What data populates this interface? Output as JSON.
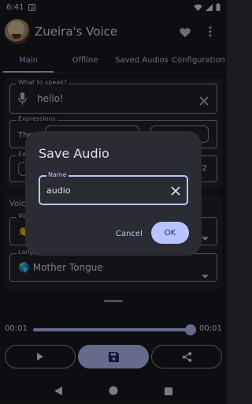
{
  "status_bar": {
    "time": "6:41",
    "notification_letter": "A"
  },
  "app_bar": {
    "title": "Zueira's Voice"
  },
  "tabs": [
    {
      "label": "Main",
      "active": true
    },
    {
      "label": "Offline",
      "active": false
    },
    {
      "label": "Saved Audios",
      "active": false
    },
    {
      "label": "Configuration",
      "active": false
    }
  ],
  "main": {
    "speak_field": {
      "label": "What to speak?",
      "value": "hello!"
    },
    "expressions": {
      "label": "Expressions",
      "partial_value": "The"
    },
    "second_field": {
      "label": "Ex",
      "partial_value": "2"
    },
    "voice_section": {
      "title": "Voic",
      "voice_label": "Vo",
      "voice_emoji": "👏"
    },
    "language": {
      "label": "Lang",
      "value": "🌎 Mother Tongue"
    }
  },
  "dialog": {
    "title": "Save Audio",
    "name_label": "Name",
    "name_value": "audio",
    "cancel_label": "Cancel",
    "ok_label": "OK"
  },
  "player": {
    "current_time": "00:01",
    "total_time": "00:01",
    "progress": 1.0
  },
  "colors": {
    "accent": "#b7c4ff",
    "background": "#1b1b21",
    "dialog": "#2a2b33"
  }
}
